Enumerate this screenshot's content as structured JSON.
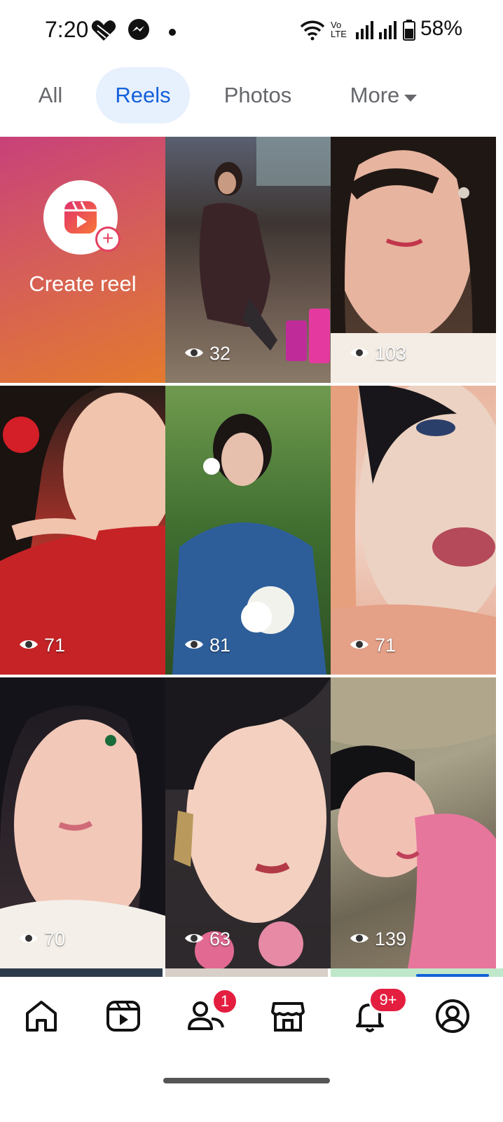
{
  "status_bar": {
    "time": "7:20",
    "network_label": "Vo LTE",
    "battery_percent": "58%"
  },
  "tabs": [
    {
      "label": "All",
      "active": false
    },
    {
      "label": "Reels",
      "active": true
    },
    {
      "label": "Photos",
      "active": false
    },
    {
      "label": "More",
      "active": false
    }
  ],
  "create_reel": {
    "label": "Create reel"
  },
  "reels": [
    {
      "views": "32"
    },
    {
      "views": "103"
    },
    {
      "views": "71"
    },
    {
      "views": "81"
    },
    {
      "views": "71"
    },
    {
      "views": "70"
    },
    {
      "views": "63"
    },
    {
      "views": "139"
    }
  ],
  "bottom_nav": {
    "friends_badge": "1",
    "notifications_badge": "9+"
  },
  "colors": {
    "accent": "#1360d9",
    "active_tab_bg": "#e7f0fd",
    "badge": "#e41e3f"
  }
}
